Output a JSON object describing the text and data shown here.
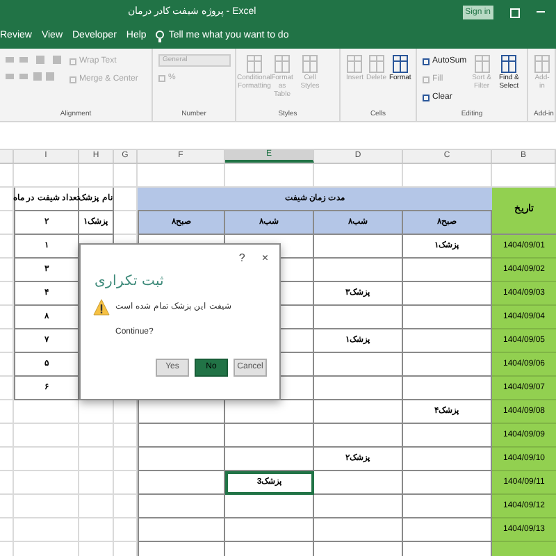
{
  "title_bar": {
    "title": "پروژه شیفت کادر درمان - Excel",
    "sign_in": "Sign in"
  },
  "tabs": [
    {
      "label": "Review"
    },
    {
      "label": "View"
    },
    {
      "label": "Developer"
    },
    {
      "label": "Help"
    }
  ],
  "tell_me": "Tell me what you want to do",
  "ribbon": [
    {
      "label": "Alignment",
      "items": [
        {
          "kind": "small",
          "label": "Wrap Text",
          "disabled": true
        },
        {
          "kind": "small",
          "label": "Merge & Center",
          "disabled": true
        }
      ]
    },
    {
      "label": "Number",
      "items": [
        {
          "kind": "combo",
          "label": "General",
          "disabled": true
        },
        {
          "kind": "small",
          "label": "%",
          "disabled": true
        }
      ]
    },
    {
      "label": "Styles",
      "items": [
        {
          "kind": "large",
          "label": "Conditional Formatting",
          "disabled": true
        },
        {
          "kind": "large",
          "label": "Format as Table",
          "disabled": true
        },
        {
          "kind": "large",
          "label": "Cell Styles",
          "disabled": true
        }
      ]
    },
    {
      "label": "Cells",
      "items": [
        {
          "kind": "large",
          "label": "Insert",
          "disabled": true
        },
        {
          "kind": "large",
          "label": "Delete",
          "disabled": true
        },
        {
          "kind": "large",
          "label": "Format",
          "disabled": false
        }
      ]
    },
    {
      "label": "Editing",
      "items": [
        {
          "kind": "small",
          "label": "AutoSum",
          "disabled": false
        },
        {
          "kind": "small",
          "label": "Fill",
          "disabled": true
        },
        {
          "kind": "small",
          "label": "Clear",
          "disabled": false
        },
        {
          "kind": "large",
          "label": "Sort & Filter",
          "disabled": true
        },
        {
          "kind": "large",
          "label": "Find & Select",
          "disabled": false
        }
      ]
    },
    {
      "label": "Add-in",
      "items": [
        {
          "kind": "large",
          "label": "Add-in",
          "disabled": true
        }
      ]
    }
  ],
  "columns": [
    {
      "label": "I",
      "selected": false
    },
    {
      "label": "H",
      "selected": false
    },
    {
      "label": "G",
      "selected": false
    },
    {
      "label": "F",
      "selected": false
    },
    {
      "label": "E",
      "selected": true
    },
    {
      "label": "D",
      "selected": false
    },
    {
      "label": "C",
      "selected": false
    },
    {
      "label": "B",
      "selected": false
    }
  ],
  "doctors": {
    "count_header": "تعداد شیفت در ماه",
    "name_header": "نام پزشک",
    "rows": [
      {
        "count": "۲",
        "name": "پزشک۱"
      },
      {
        "count": "۱"
      },
      {
        "count": "۳"
      },
      {
        "count": "۴"
      },
      {
        "count": "۸"
      },
      {
        "count": "۷"
      },
      {
        "count": "۵"
      },
      {
        "count": "۶"
      }
    ]
  },
  "schedule": {
    "date_header": "تاریخ",
    "title": "مدت زمان شیفت",
    "shifts": [
      "۸صبح",
      "۸شب",
      "۸شب",
      "۸صبح"
    ],
    "rows": [
      {
        "date": "1404/09/01",
        "cells": [
          {
            "text": "پزشک۱",
            "selected": false
          },
          {
            "selected": false
          },
          {
            "selected": false
          }
        ]
      },
      {
        "date": "1404/09/02",
        "cells": [
          {
            "selected": false
          },
          {
            "selected": false
          },
          {
            "selected": false
          }
        ]
      },
      {
        "date": "1404/09/03",
        "cells": [
          {
            "selected": false
          },
          {
            "text": "پزشک۳",
            "selected": false
          },
          {
            "selected": false
          }
        ]
      },
      {
        "date": "1404/09/04",
        "cells": [
          {
            "selected": false
          },
          {
            "selected": false
          },
          {
            "selected": false
          }
        ]
      },
      {
        "date": "1404/09/05",
        "cells": [
          {
            "selected": false
          },
          {
            "text": "پزشک۱",
            "selected": false
          },
          {
            "selected": false
          }
        ]
      },
      {
        "date": "1404/09/06",
        "cells": [
          {
            "selected": false
          },
          {
            "selected": false
          },
          {
            "selected": false
          }
        ]
      },
      {
        "date": "1404/09/07",
        "cells": [
          {
            "selected": false
          },
          {
            "selected": false
          },
          {
            "selected": false
          }
        ]
      },
      {
        "date": "1404/09/08",
        "cells": [
          {
            "text": "پزشک۴",
            "selected": false
          },
          {
            "selected": false
          },
          {
            "selected": false
          },
          {
            "selected": false
          }
        ]
      },
      {
        "date": "1404/09/09",
        "cells": [
          {
            "selected": false
          },
          {
            "selected": false
          },
          {
            "selected": false
          },
          {
            "selected": false
          }
        ]
      },
      {
        "date": "1404/09/10",
        "cells": [
          {
            "selected": false
          },
          {
            "text": "پزشک۲",
            "selected": false
          },
          {
            "selected": false
          },
          {
            "selected": false
          }
        ]
      },
      {
        "date": "1404/09/11",
        "cells": [
          {
            "selected": false
          },
          {
            "selected": false
          },
          {
            "text": "پزشک3",
            "selected": true
          },
          {
            "selected": false
          }
        ]
      },
      {
        "date": "1404/09/12",
        "cells": [
          {
            "selected": false
          },
          {
            "selected": false
          },
          {
            "selected": false
          },
          {
            "selected": false
          }
        ]
      },
      {
        "date": "1404/09/13",
        "cells": [
          {
            "selected": false
          },
          {
            "selected": false
          },
          {
            "selected": false
          },
          {
            "selected": false
          }
        ]
      }
    ]
  },
  "dialog": {
    "help": "?",
    "close": "×",
    "heading": "ثبت تکراری",
    "message": "شیفت این پزشک تمام شده است",
    "question": "Continue?",
    "buttons": [
      {
        "label": "Yes",
        "selected": false
      },
      {
        "label": "No",
        "selected": true
      },
      {
        "label": "Cancel",
        "selected": false
      }
    ]
  }
}
